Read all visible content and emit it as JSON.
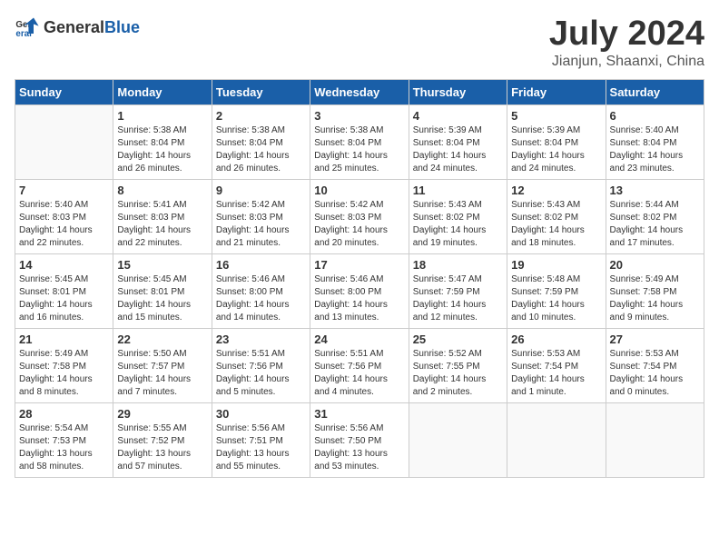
{
  "header": {
    "logo_general": "General",
    "logo_blue": "Blue",
    "month_year": "July 2024",
    "location": "Jianjun, Shaanxi, China"
  },
  "weekdays": [
    "Sunday",
    "Monday",
    "Tuesday",
    "Wednesday",
    "Thursday",
    "Friday",
    "Saturday"
  ],
  "weeks": [
    [
      {
        "day": "",
        "info": ""
      },
      {
        "day": "1",
        "info": "Sunrise: 5:38 AM\nSunset: 8:04 PM\nDaylight: 14 hours\nand 26 minutes."
      },
      {
        "day": "2",
        "info": "Sunrise: 5:38 AM\nSunset: 8:04 PM\nDaylight: 14 hours\nand 26 minutes."
      },
      {
        "day": "3",
        "info": "Sunrise: 5:38 AM\nSunset: 8:04 PM\nDaylight: 14 hours\nand 25 minutes."
      },
      {
        "day": "4",
        "info": "Sunrise: 5:39 AM\nSunset: 8:04 PM\nDaylight: 14 hours\nand 24 minutes."
      },
      {
        "day": "5",
        "info": "Sunrise: 5:39 AM\nSunset: 8:04 PM\nDaylight: 14 hours\nand 24 minutes."
      },
      {
        "day": "6",
        "info": "Sunrise: 5:40 AM\nSunset: 8:04 PM\nDaylight: 14 hours\nand 23 minutes."
      }
    ],
    [
      {
        "day": "7",
        "info": "Sunrise: 5:40 AM\nSunset: 8:03 PM\nDaylight: 14 hours\nand 22 minutes."
      },
      {
        "day": "8",
        "info": "Sunrise: 5:41 AM\nSunset: 8:03 PM\nDaylight: 14 hours\nand 22 minutes."
      },
      {
        "day": "9",
        "info": "Sunrise: 5:42 AM\nSunset: 8:03 PM\nDaylight: 14 hours\nand 21 minutes."
      },
      {
        "day": "10",
        "info": "Sunrise: 5:42 AM\nSunset: 8:03 PM\nDaylight: 14 hours\nand 20 minutes."
      },
      {
        "day": "11",
        "info": "Sunrise: 5:43 AM\nSunset: 8:02 PM\nDaylight: 14 hours\nand 19 minutes."
      },
      {
        "day": "12",
        "info": "Sunrise: 5:43 AM\nSunset: 8:02 PM\nDaylight: 14 hours\nand 18 minutes."
      },
      {
        "day": "13",
        "info": "Sunrise: 5:44 AM\nSunset: 8:02 PM\nDaylight: 14 hours\nand 17 minutes."
      }
    ],
    [
      {
        "day": "14",
        "info": "Sunrise: 5:45 AM\nSunset: 8:01 PM\nDaylight: 14 hours\nand 16 minutes."
      },
      {
        "day": "15",
        "info": "Sunrise: 5:45 AM\nSunset: 8:01 PM\nDaylight: 14 hours\nand 15 minutes."
      },
      {
        "day": "16",
        "info": "Sunrise: 5:46 AM\nSunset: 8:00 PM\nDaylight: 14 hours\nand 14 minutes."
      },
      {
        "day": "17",
        "info": "Sunrise: 5:46 AM\nSunset: 8:00 PM\nDaylight: 14 hours\nand 13 minutes."
      },
      {
        "day": "18",
        "info": "Sunrise: 5:47 AM\nSunset: 7:59 PM\nDaylight: 14 hours\nand 12 minutes."
      },
      {
        "day": "19",
        "info": "Sunrise: 5:48 AM\nSunset: 7:59 PM\nDaylight: 14 hours\nand 10 minutes."
      },
      {
        "day": "20",
        "info": "Sunrise: 5:49 AM\nSunset: 7:58 PM\nDaylight: 14 hours\nand 9 minutes."
      }
    ],
    [
      {
        "day": "21",
        "info": "Sunrise: 5:49 AM\nSunset: 7:58 PM\nDaylight: 14 hours\nand 8 minutes."
      },
      {
        "day": "22",
        "info": "Sunrise: 5:50 AM\nSunset: 7:57 PM\nDaylight: 14 hours\nand 7 minutes."
      },
      {
        "day": "23",
        "info": "Sunrise: 5:51 AM\nSunset: 7:56 PM\nDaylight: 14 hours\nand 5 minutes."
      },
      {
        "day": "24",
        "info": "Sunrise: 5:51 AM\nSunset: 7:56 PM\nDaylight: 14 hours\nand 4 minutes."
      },
      {
        "day": "25",
        "info": "Sunrise: 5:52 AM\nSunset: 7:55 PM\nDaylight: 14 hours\nand 2 minutes."
      },
      {
        "day": "26",
        "info": "Sunrise: 5:53 AM\nSunset: 7:54 PM\nDaylight: 14 hours\nand 1 minute."
      },
      {
        "day": "27",
        "info": "Sunrise: 5:53 AM\nSunset: 7:54 PM\nDaylight: 14 hours\nand 0 minutes."
      }
    ],
    [
      {
        "day": "28",
        "info": "Sunrise: 5:54 AM\nSunset: 7:53 PM\nDaylight: 13 hours\nand 58 minutes."
      },
      {
        "day": "29",
        "info": "Sunrise: 5:55 AM\nSunset: 7:52 PM\nDaylight: 13 hours\nand 57 minutes."
      },
      {
        "day": "30",
        "info": "Sunrise: 5:56 AM\nSunset: 7:51 PM\nDaylight: 13 hours\nand 55 minutes."
      },
      {
        "day": "31",
        "info": "Sunrise: 5:56 AM\nSunset: 7:50 PM\nDaylight: 13 hours\nand 53 minutes."
      },
      {
        "day": "",
        "info": ""
      },
      {
        "day": "",
        "info": ""
      },
      {
        "day": "",
        "info": ""
      }
    ]
  ]
}
